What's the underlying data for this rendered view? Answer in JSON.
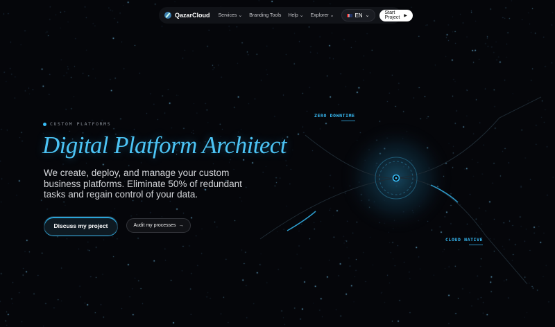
{
  "nav": {
    "brand": "QazarCloud",
    "items": [
      {
        "label": "Services",
        "dropdown": true
      },
      {
        "label": "Branding Tools",
        "dropdown": false
      },
      {
        "label": "Help",
        "dropdown": true
      },
      {
        "label": "Explorer",
        "dropdown": true
      }
    ],
    "language": "EN",
    "cta": "Start Project"
  },
  "hero": {
    "eyebrow": "CUSTOM PLATFORMS",
    "title": "Digital Platform Architect",
    "description": "We create, deploy, and manage your custom business platforms. Eliminate 50% of redundant tasks and regain control of your data.",
    "primary_button": "Discuss my project",
    "secondary_button": "Audit my processes"
  },
  "viz": {
    "tag_top": "ZERO DOWNTIME",
    "tag_bottom": "CLOUD NATIVE"
  },
  "colors": {
    "accent": "#38bdf8",
    "background": "#05060a"
  }
}
